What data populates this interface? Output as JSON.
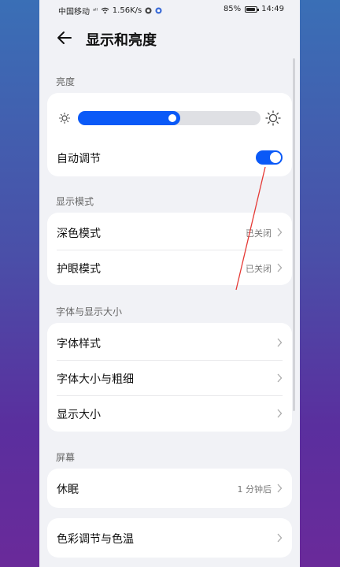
{
  "status_bar": {
    "carrier": "中国移动",
    "signal": "ᵃˡˡ",
    "speed": "1.56K/s",
    "battery": "85%",
    "time": "14:49"
  },
  "header": {
    "title": "显示和亮度",
    "back_icon": "back-arrow-icon"
  },
  "brightness": {
    "section_label": "亮度",
    "level_percent": 56,
    "auto_label": "自动调节",
    "auto_enabled": true
  },
  "display_mode": {
    "section_label": "显示模式",
    "items": [
      {
        "label": "深色模式",
        "value": "已关闭"
      },
      {
        "label": "护眼模式",
        "value": "已关闭"
      }
    ]
  },
  "font_size": {
    "section_label": "字体与显示大小",
    "items": [
      {
        "label": "字体样式"
      },
      {
        "label": "字体大小与粗细"
      },
      {
        "label": "显示大小"
      }
    ]
  },
  "screen": {
    "section_label": "屏幕",
    "sleep_label": "休眠",
    "sleep_value": "1 分钟后",
    "color_label": "色彩调节与色温"
  },
  "colors": {
    "accent": "#0a59f7",
    "annotation": "#e53935"
  }
}
